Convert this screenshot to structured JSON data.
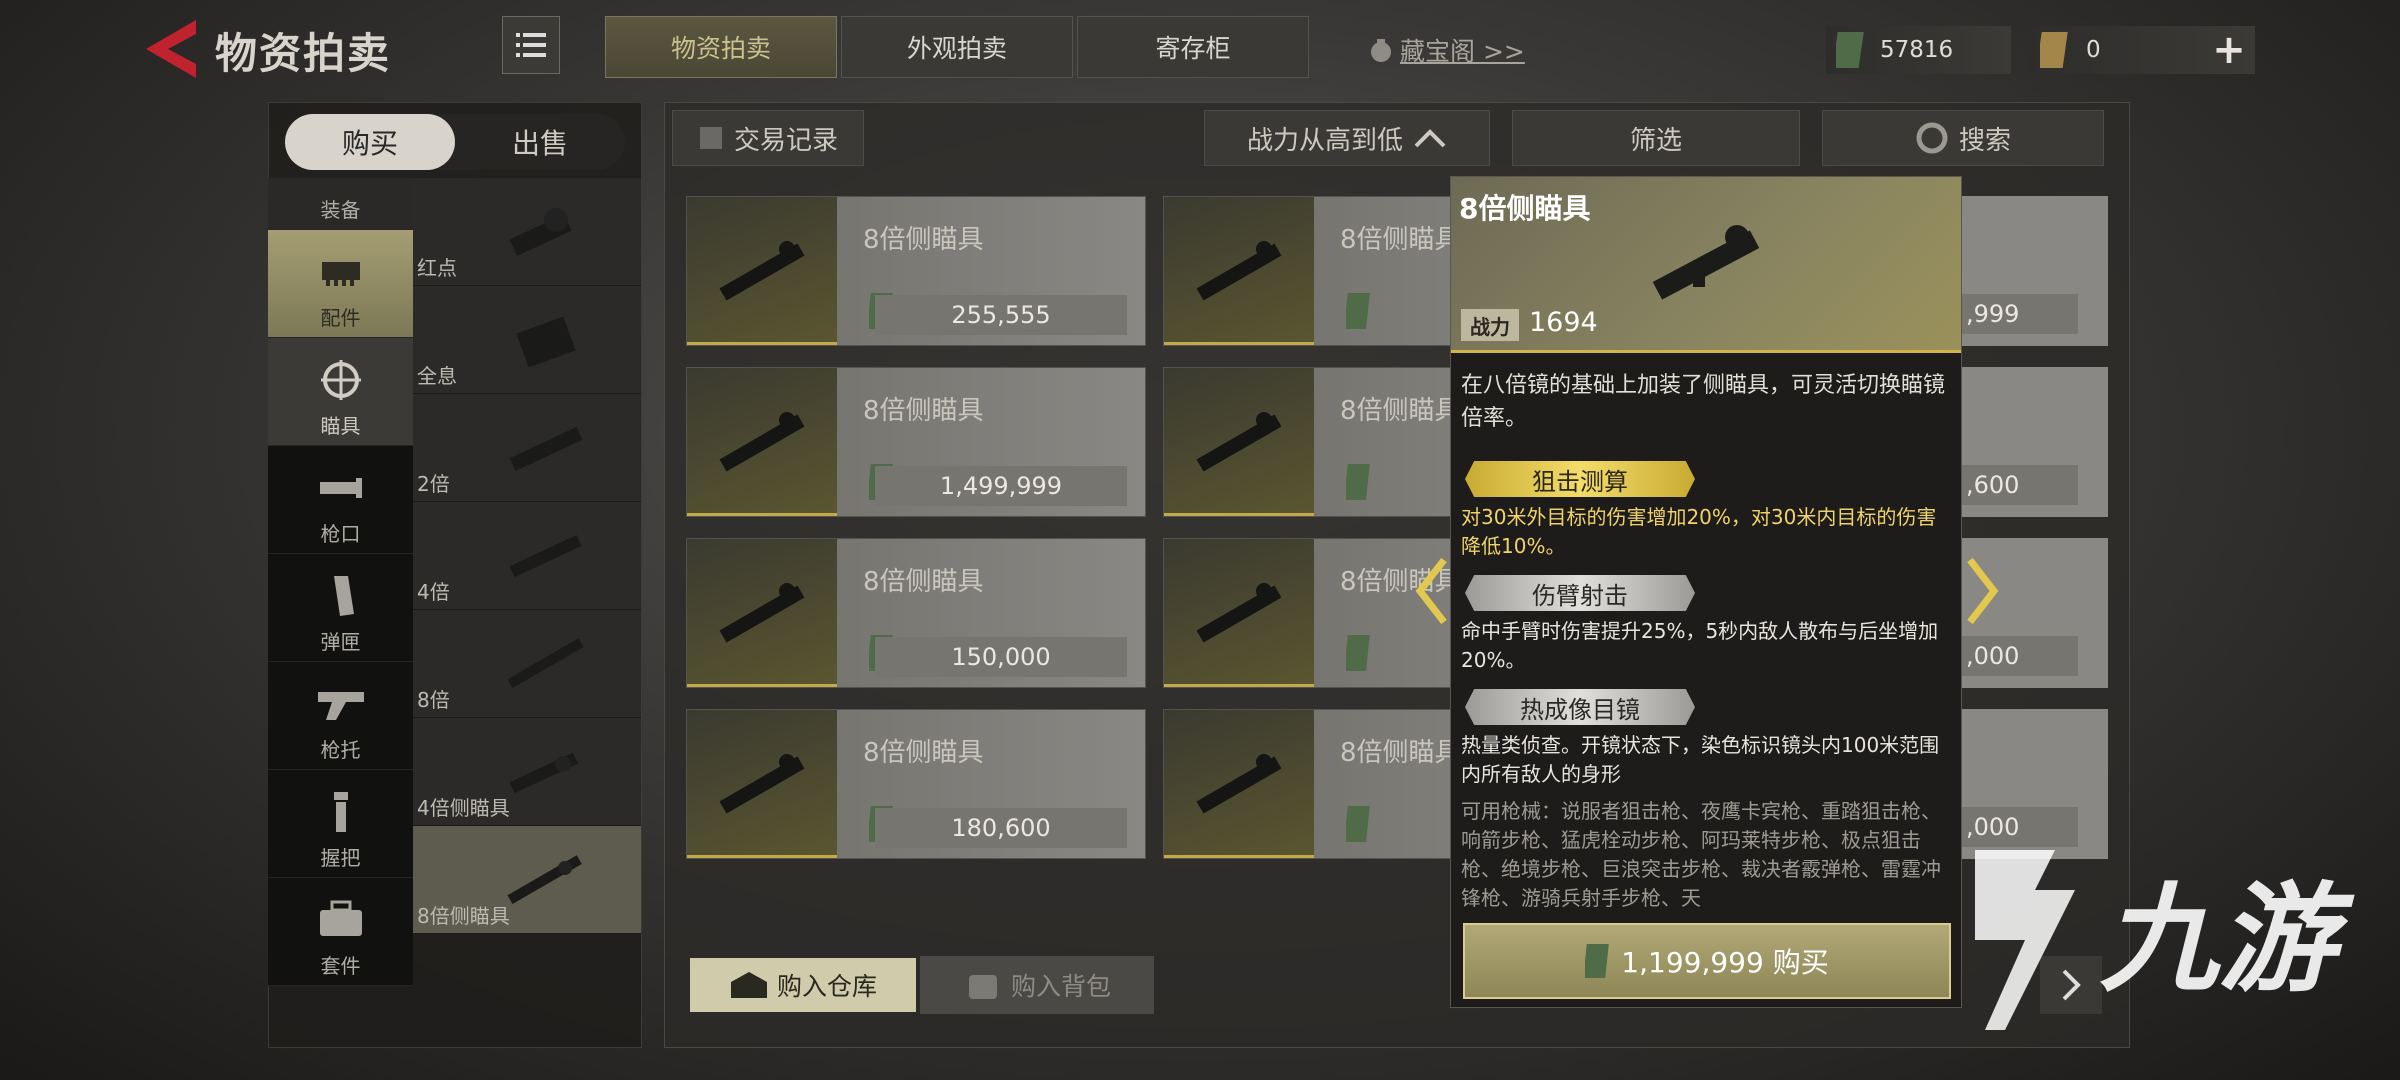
{
  "header": {
    "title": "物资拍卖",
    "tabs": [
      {
        "label": "物资拍卖",
        "active": true
      },
      {
        "label": "外观拍卖",
        "active": false
      },
      {
        "label": "寄存柜",
        "active": false
      }
    ],
    "treasure_link": "藏宝阁 >>",
    "currency_cash": "57816",
    "currency_gold": "0"
  },
  "left": {
    "segment": {
      "buy": "购买",
      "sell": "出售"
    },
    "categories": [
      {
        "label": "装备",
        "icon": "equipment-icon"
      },
      {
        "label": "配件",
        "icon": "attachment-icon"
      },
      {
        "label": "瞄具",
        "icon": "scope-icon"
      },
      {
        "label": "枪口",
        "icon": "muzzle-icon"
      },
      {
        "label": "弹匣",
        "icon": "magazine-icon"
      },
      {
        "label": "枪托",
        "icon": "stock-icon"
      },
      {
        "label": "握把",
        "icon": "grip-icon"
      },
      {
        "label": "套件",
        "icon": "kit-icon"
      }
    ],
    "subitems": [
      {
        "label": "红点"
      },
      {
        "label": "全息"
      },
      {
        "label": "2倍"
      },
      {
        "label": "4倍"
      },
      {
        "label": "8倍"
      },
      {
        "label": "4倍侧瞄具"
      },
      {
        "label": "8倍侧瞄具"
      }
    ]
  },
  "toolbar": {
    "record": "交易记录",
    "sort": "战力从高到低",
    "filter": "筛选",
    "search": "搜索"
  },
  "listings": [
    {
      "name": "8倍侧瞄具",
      "price": "255,555"
    },
    {
      "name": "8倍侧瞄具",
      "price": "1,499,999"
    },
    {
      "name": "8倍侧瞄具",
      "price": "150,000"
    },
    {
      "name": "8倍侧瞄具",
      "price": "180,600"
    },
    {
      "name": "8倍侧瞄具",
      "price": ""
    },
    {
      "name": "8倍侧瞄具",
      "price": ""
    },
    {
      "name": "8倍侧瞄具",
      "price": ""
    },
    {
      "name": "8倍侧瞄具",
      "price": ""
    }
  ],
  "right_partial_prices": [
    ",999",
    ",600",
    ",000",
    ",000"
  ],
  "actions": {
    "buy_warehouse": "购入仓库",
    "buy_bag": "购入背包"
  },
  "popup": {
    "title": "8倍侧瞄具",
    "power_label": "战力",
    "power_value": "1694",
    "description": "在八倍镜的基础上加装了侧瞄具，可灵活切换瞄镜倍率。",
    "skills": [
      {
        "name": "狙击测算",
        "style": "gold",
        "text": "对30米外目标的伤害增加20%，对30米内目标的伤害降低10%。"
      },
      {
        "name": "伤臂射击",
        "style": "silver",
        "text": "命中手臂时伤害提升25%，5秒内敌人散布与后坐增加20%。"
      },
      {
        "name": "热成像目镜",
        "style": "silver",
        "text": "热量类侦查。开镜状态下，染色标识镜头内100米范围内所有敌人的身形"
      }
    ],
    "weapons": "可用枪械：说服者狙击枪、夜鹰卡宾枪、重踏狙击枪、响箭步枪、猛虎栓动步枪、阿玛莱特步枪、极点狙击枪、绝境步枪、巨浪突击步枪、裁决者霰弹枪、雷霆冲锋枪、游骑兵射手步枪、天",
    "buy_label": "1,199,999 购买"
  },
  "watermark": "九游",
  "colors": {
    "accent_gold": "#d1b44a",
    "highlight": "#c7aa32",
    "back_arrow": "#c0222e"
  }
}
